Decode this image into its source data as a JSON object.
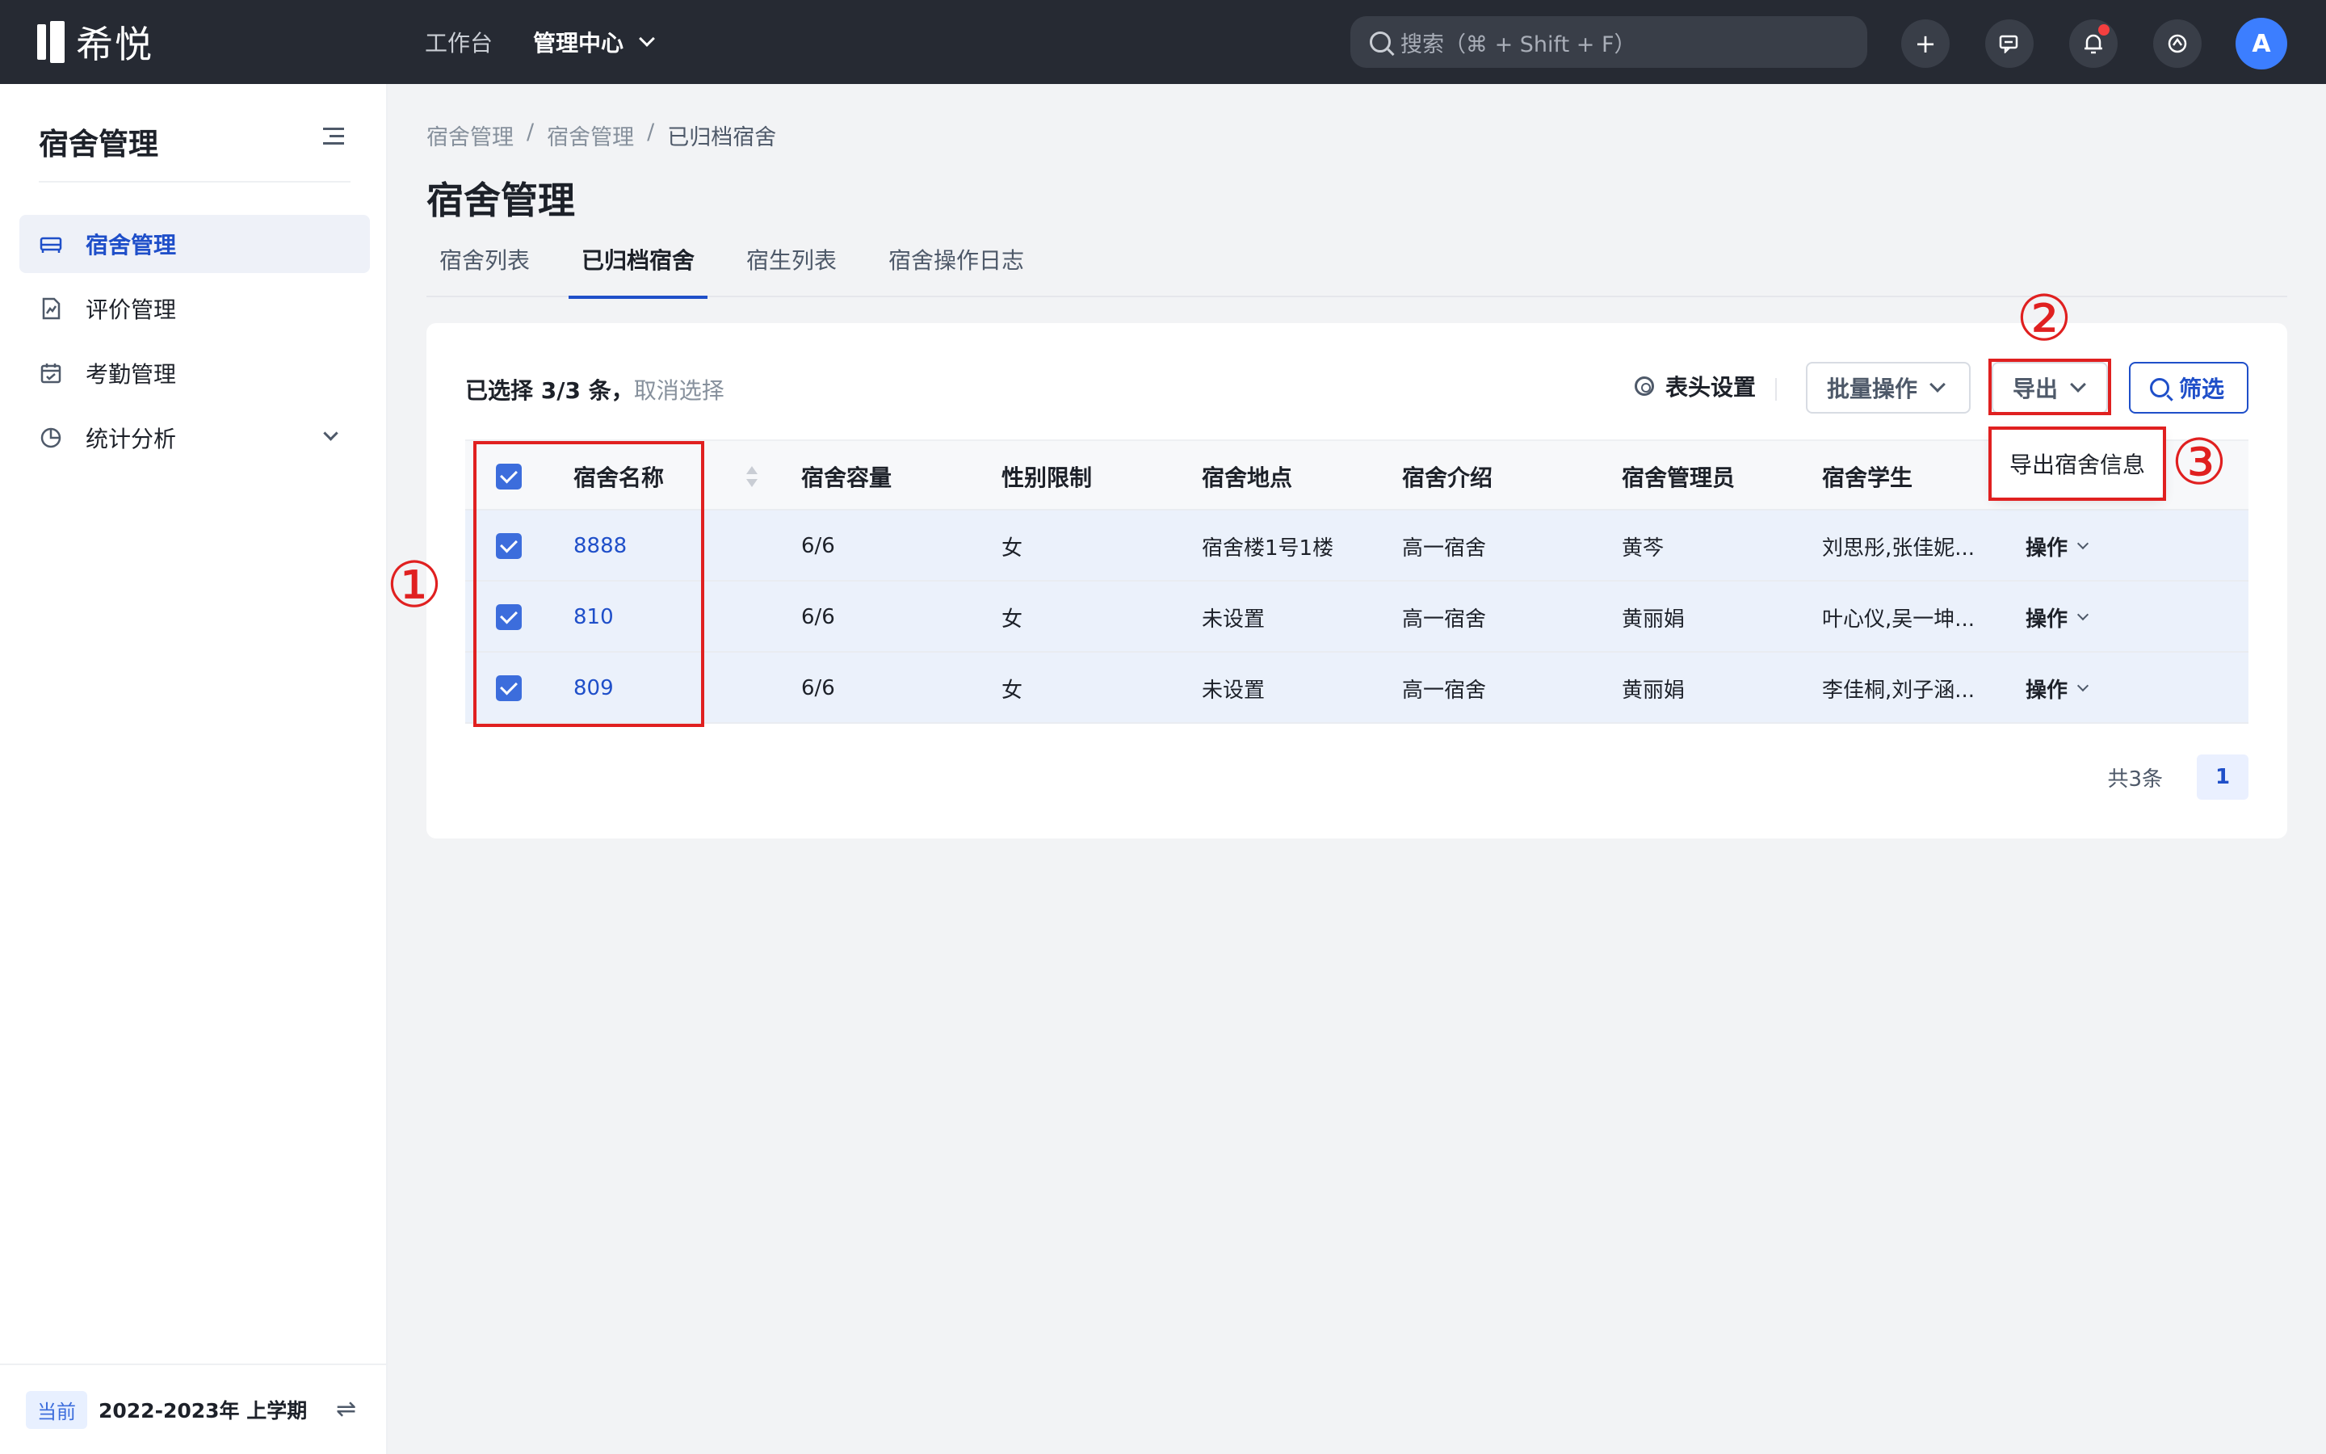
{
  "topbar": {
    "logo_text": "希悦",
    "nav": [
      {
        "label": "工作台"
      },
      {
        "label": "管理中心"
      }
    ],
    "search_placeholder": "搜索（⌘ + Shift + F）",
    "add_icon": "plus-icon",
    "message_icon": "message-icon",
    "bell_icon": "bell-icon",
    "help_icon": "refresh-icon",
    "avatar_letter": "A",
    "accent": "#3c7eff"
  },
  "sidebar": {
    "title": "宿舍管理",
    "items": [
      {
        "label": "宿舍管理",
        "icon": "bed-icon"
      },
      {
        "label": "评价管理",
        "icon": "evaluation-icon"
      },
      {
        "label": "考勤管理",
        "icon": "calendar-icon"
      },
      {
        "label": "统计分析",
        "icon": "pie-chart-icon"
      }
    ],
    "term_badge": "当前",
    "term_text": "2022-2023年 上学期"
  },
  "breadcrumb": [
    "宿舍管理",
    "宿舍管理",
    "已归档宿舍"
  ],
  "page_title": "宿舍管理",
  "tabs": [
    {
      "label": "宿舍列表"
    },
    {
      "label": "已归档宿舍"
    },
    {
      "label": "宿生列表"
    },
    {
      "label": "宿舍操作日志"
    }
  ],
  "toolbar": {
    "selection_text": "已选择 3/3 条，",
    "cancel_selection": "取消选择",
    "header_settings": "表头设置",
    "batch_ops": "批量操作",
    "export": "导出",
    "filter": "筛选"
  },
  "export_menu": {
    "item": "导出宿舍信息"
  },
  "table": {
    "columns": [
      "宿舍名称",
      "宿舍容量",
      "性别限制",
      "宿舍地点",
      "宿舍介绍",
      "宿舍管理员",
      "宿舍学生"
    ],
    "rows": [
      {
        "name": "8888",
        "capacity": "6/6",
        "gender": "女",
        "location": "宿舍楼1号1楼",
        "intro": "高一宿舍",
        "manager": "黄芩",
        "students": "刘思彤,张佳妮...",
        "op": "操作"
      },
      {
        "name": "810",
        "capacity": "6/6",
        "gender": "女",
        "location": "未设置",
        "intro": "高一宿舍",
        "manager": "黄丽娟",
        "students": "叶心仪,吴一坤...",
        "op": "操作"
      },
      {
        "name": "809",
        "capacity": "6/6",
        "gender": "女",
        "location": "未设置",
        "intro": "高一宿舍",
        "manager": "黄丽娟",
        "students": "李佳桐,刘子涵...",
        "op": "操作"
      }
    ]
  },
  "pagination": {
    "total": "共3条",
    "current": "1"
  },
  "annotations": {
    "one": "①",
    "two": "②",
    "three": "③"
  }
}
